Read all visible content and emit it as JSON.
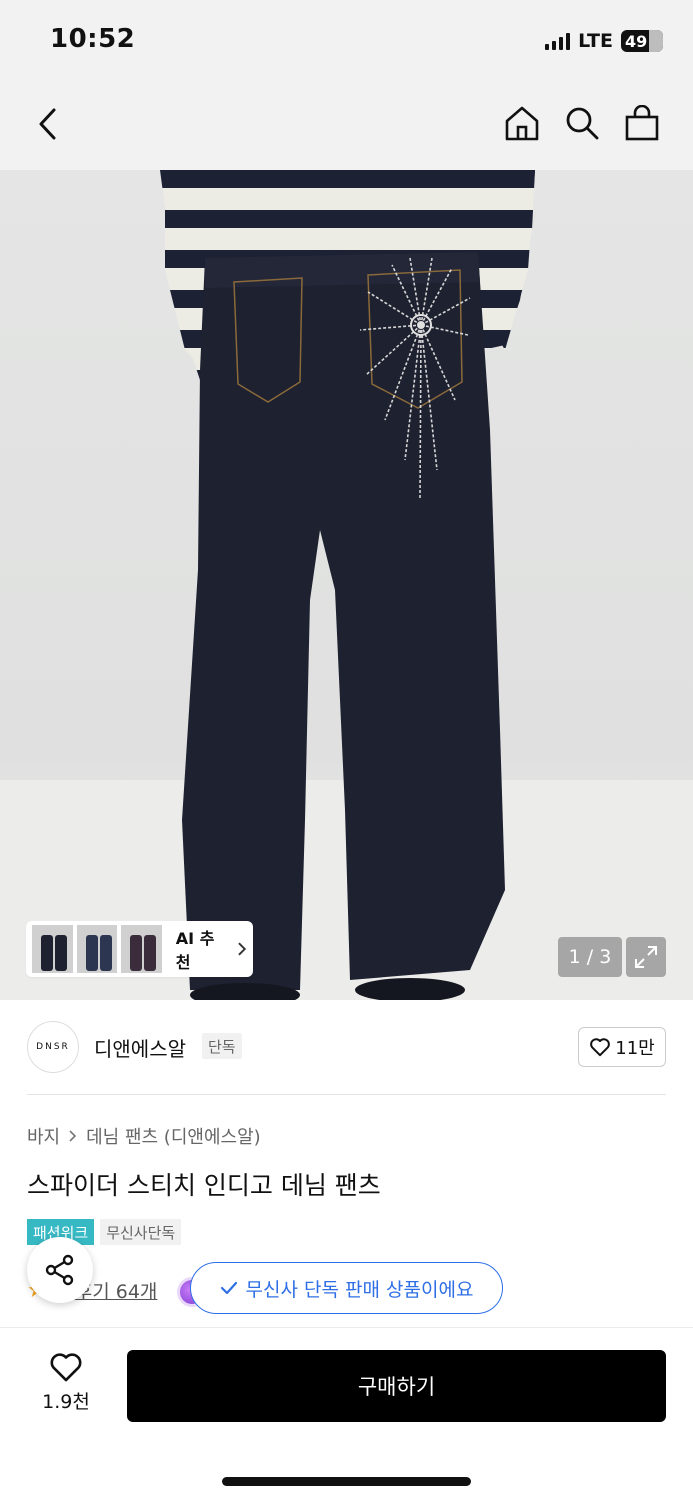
{
  "status_bar": {
    "time": "10:52",
    "network": "LTE",
    "battery": "49"
  },
  "header": {
    "back_icon": "chevron-left-icon",
    "home_icon": "home-icon",
    "search_icon": "search-icon",
    "cart_icon": "shopping-bag-icon"
  },
  "gallery": {
    "ai_label": "AI 추천",
    "counter": "1 / 3",
    "expand_icon": "expand-icon"
  },
  "brand": {
    "logo_text": "DNSR",
    "name": "디앤에스알",
    "tag": "단독",
    "likes": "11만"
  },
  "product": {
    "breadcrumb": [
      "바지",
      "데님 팬츠 (디앤에스알)"
    ],
    "title": "스파이더 스티치 인디고 데님 팬츠",
    "badges": [
      "패션위크",
      "무신사단독"
    ],
    "review_text": "후기 64개"
  },
  "toast": {
    "text": "무신사 단독 판매 상품이에요"
  },
  "bottom_bar": {
    "wish_count": "1.9천",
    "buy_label": "구매하기"
  },
  "colors": {
    "accent": "#2f6fe6",
    "badge_teal": "#37b9c4",
    "denim": "#1e2130"
  }
}
